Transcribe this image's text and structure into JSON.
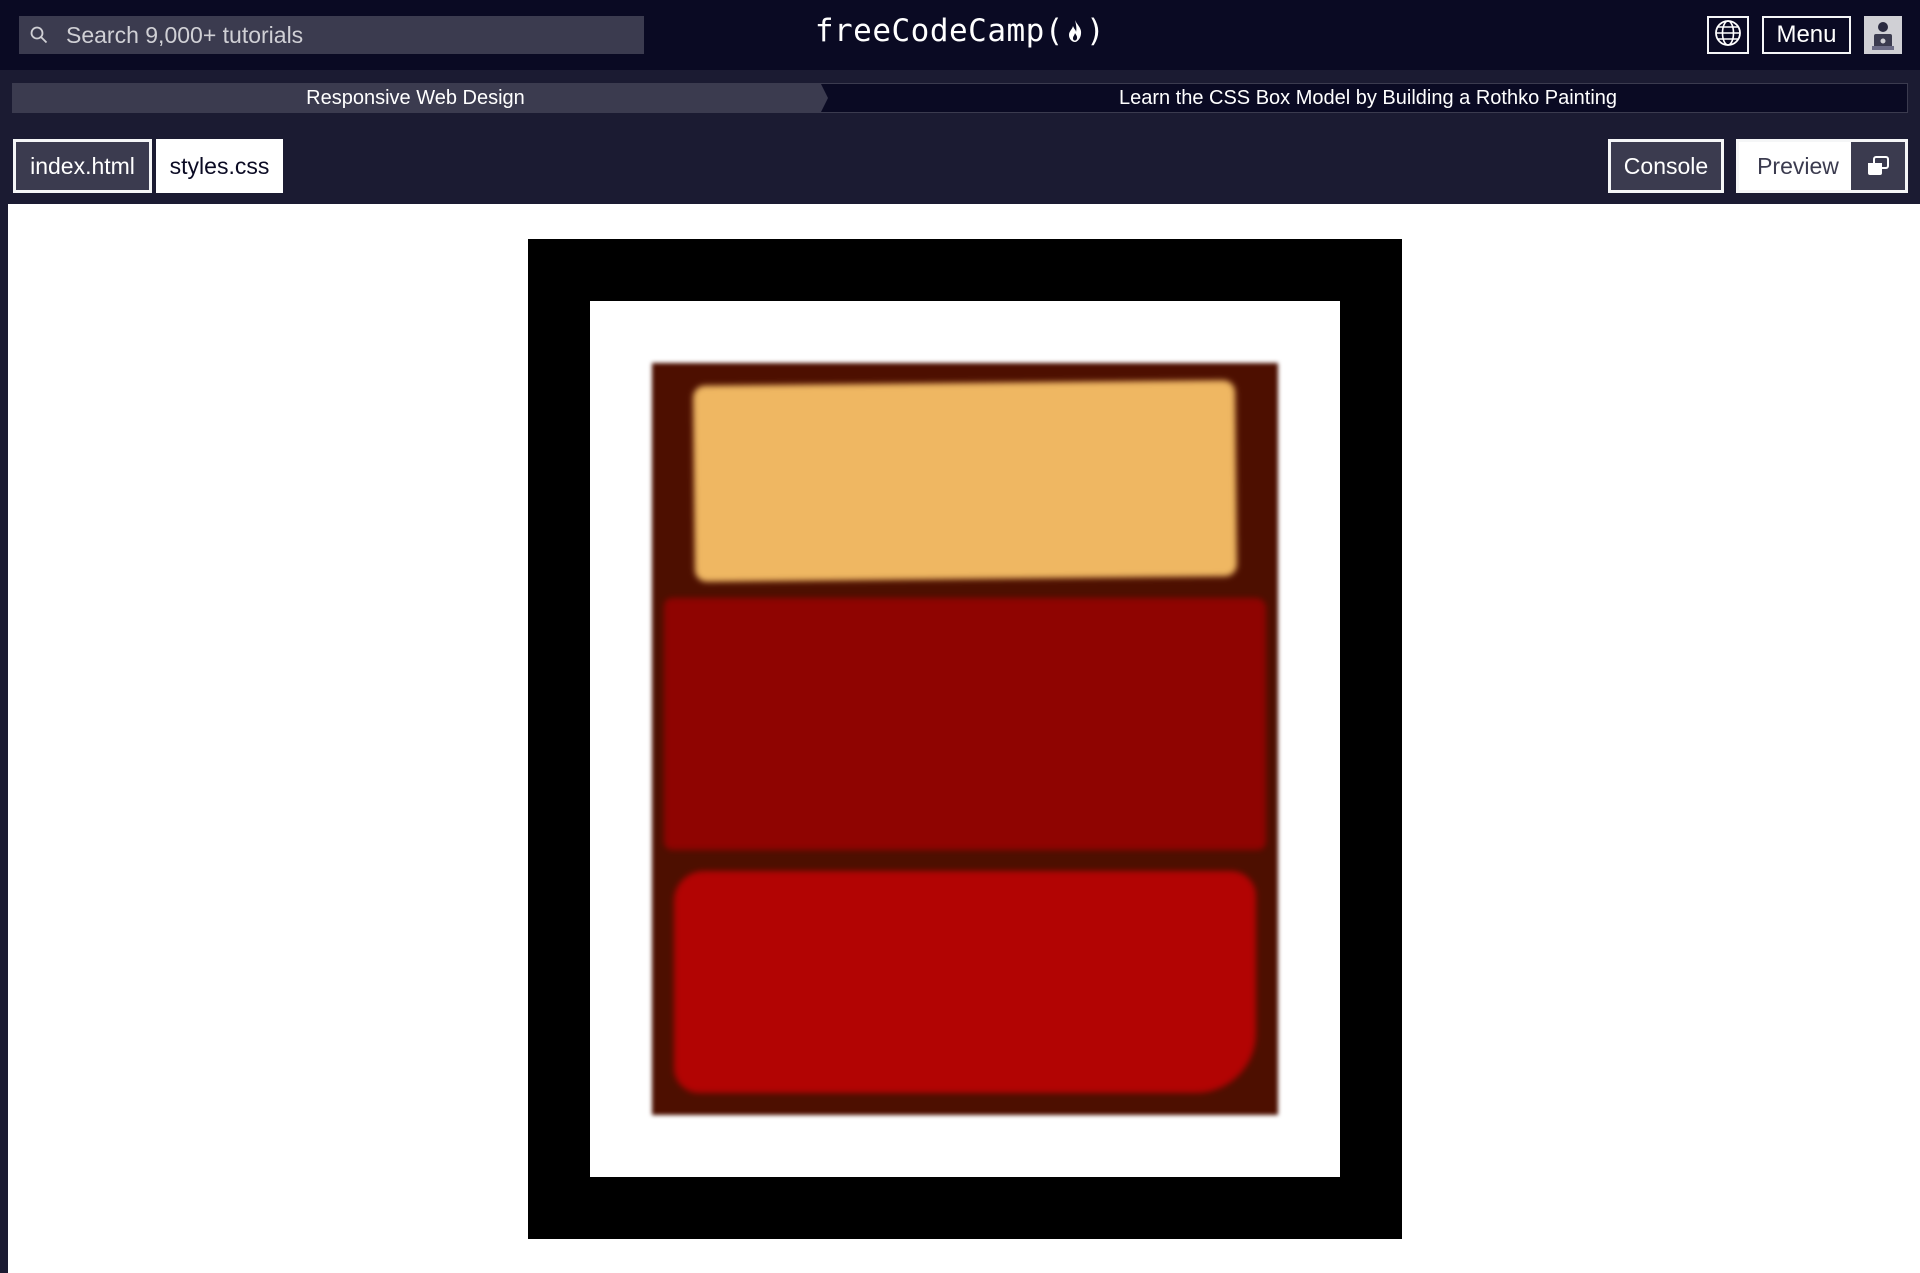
{
  "nav": {
    "search_placeholder": "Search 9,000+ tutorials",
    "logo_text_left": "freeCodeCamp(",
    "logo_text_right": ")",
    "menu_label": "Menu"
  },
  "breadcrumb": {
    "superblock": "Responsive Web Design",
    "block": "Learn the CSS Box Model by Building a Rothko Painting"
  },
  "editor_tabs": {
    "files": [
      "index.html",
      "styles.css"
    ],
    "active_file": "index.html",
    "console_label": "Console",
    "preview_label": "Preview"
  },
  "preview": {
    "frame_color": "#000000",
    "canvas_color": "#ffffff",
    "painting_color": "#4d0f00",
    "blocks": [
      {
        "name": "one",
        "color": "#efb762"
      },
      {
        "name": "two",
        "color": "#8f0401"
      },
      {
        "name": "three",
        "color": "#b20403"
      }
    ]
  },
  "icons": {
    "search": "search-icon",
    "globe": "globe-icon",
    "flame": "flame-icon",
    "avatar": "avatar-icon",
    "popout": "popout-window-icon"
  },
  "colors": {
    "nav_bg": "#0a0a23",
    "bar_bg": "#1b1b32",
    "control_bg": "#3b3b4f",
    "text_light": "#ffffff"
  }
}
